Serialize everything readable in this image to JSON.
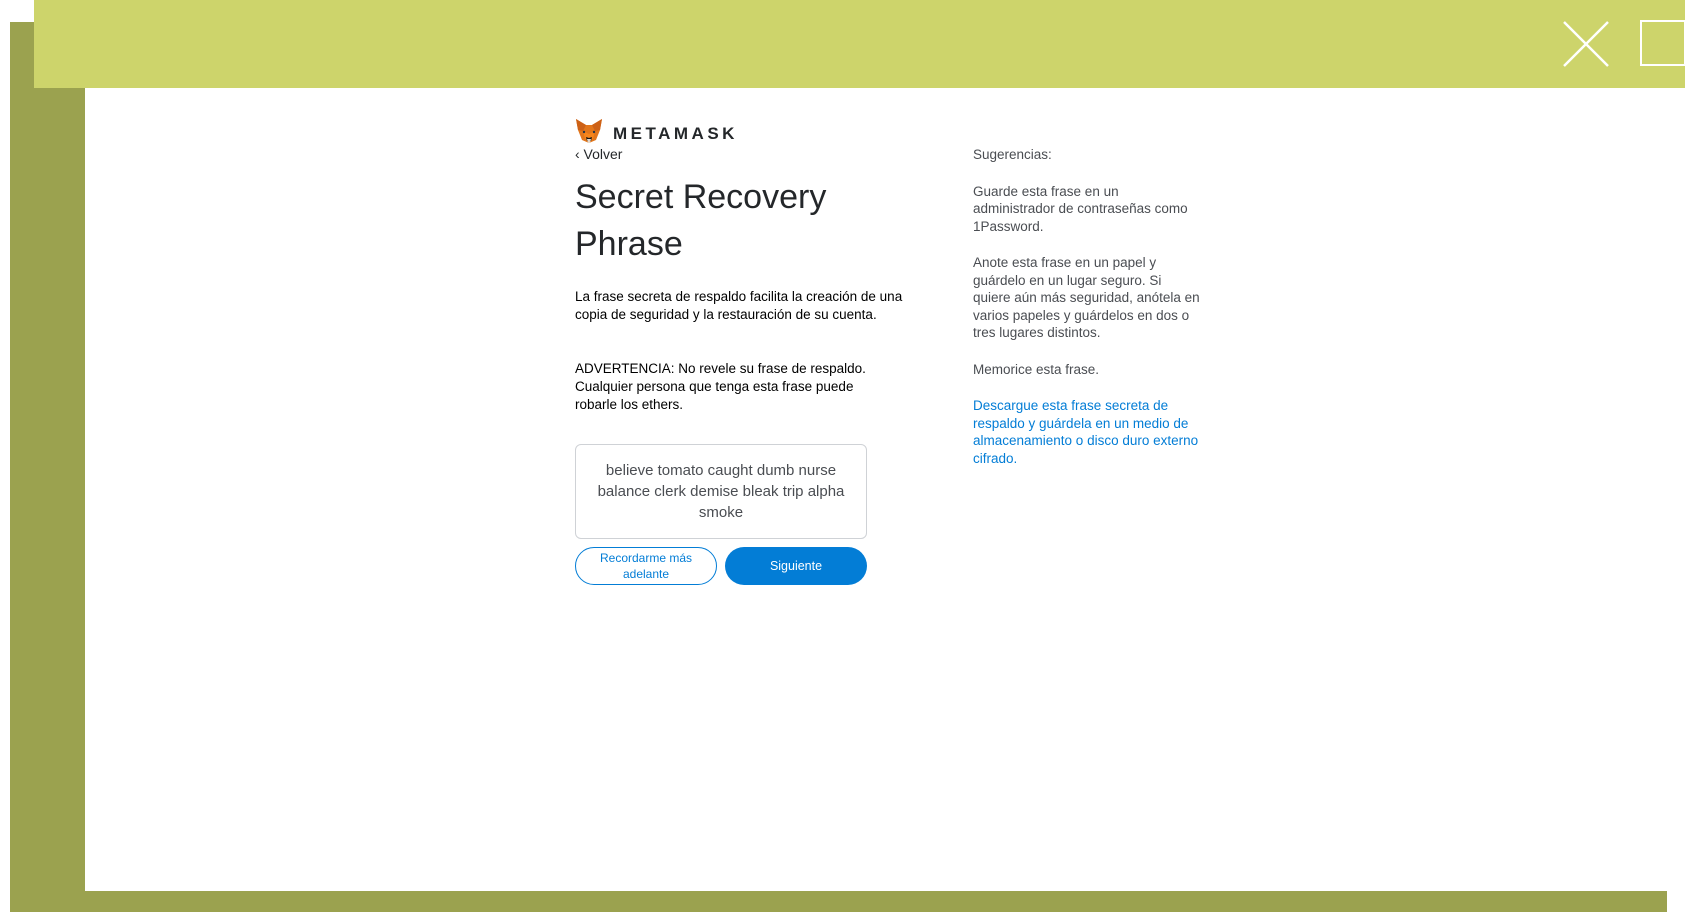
{
  "brand": {
    "logo_text": "METAMASK"
  },
  "nav": {
    "back_label": "‹ Volver"
  },
  "main": {
    "title": "Secret Recovery Phrase",
    "description": "La frase secreta de respaldo facilita la creación de una copia de seguridad y la restauración de su cuenta.",
    "warning": "ADVERTENCIA: No revele su frase de respaldo. Cualquier persona que tenga esta frase puede robarle los ethers.",
    "phrase": "believe tomato caught dumb nurse balance clerk demise bleak trip alpha smoke",
    "remind_later_label": "Recordarme más adelante",
    "next_label": "Siguiente"
  },
  "tips": {
    "heading": "Sugerencias:",
    "items": [
      "Guarde esta frase en un administrador de contraseñas como 1Password.",
      "Anote esta frase en un papel y guárdelo en un lugar seguro. Si quiere aún más seguridad, anótela en varios papeles y guárdelos en dos o tres lugares distintos.",
      "Memorice esta frase."
    ],
    "download_link": "Descargue esta frase secreta de respaldo y guárdela en un medio de almacenamiento o disco duro externo cifrado."
  },
  "colors": {
    "accent": "#037dd6",
    "frame_light": "#cdd46b",
    "frame_dark": "#9ba24f",
    "fox_orange": "#e2761b"
  },
  "icons": {
    "logo": "metamask-fox-icon",
    "window_close": "close-icon",
    "window_maximize": "maximize-icon"
  }
}
